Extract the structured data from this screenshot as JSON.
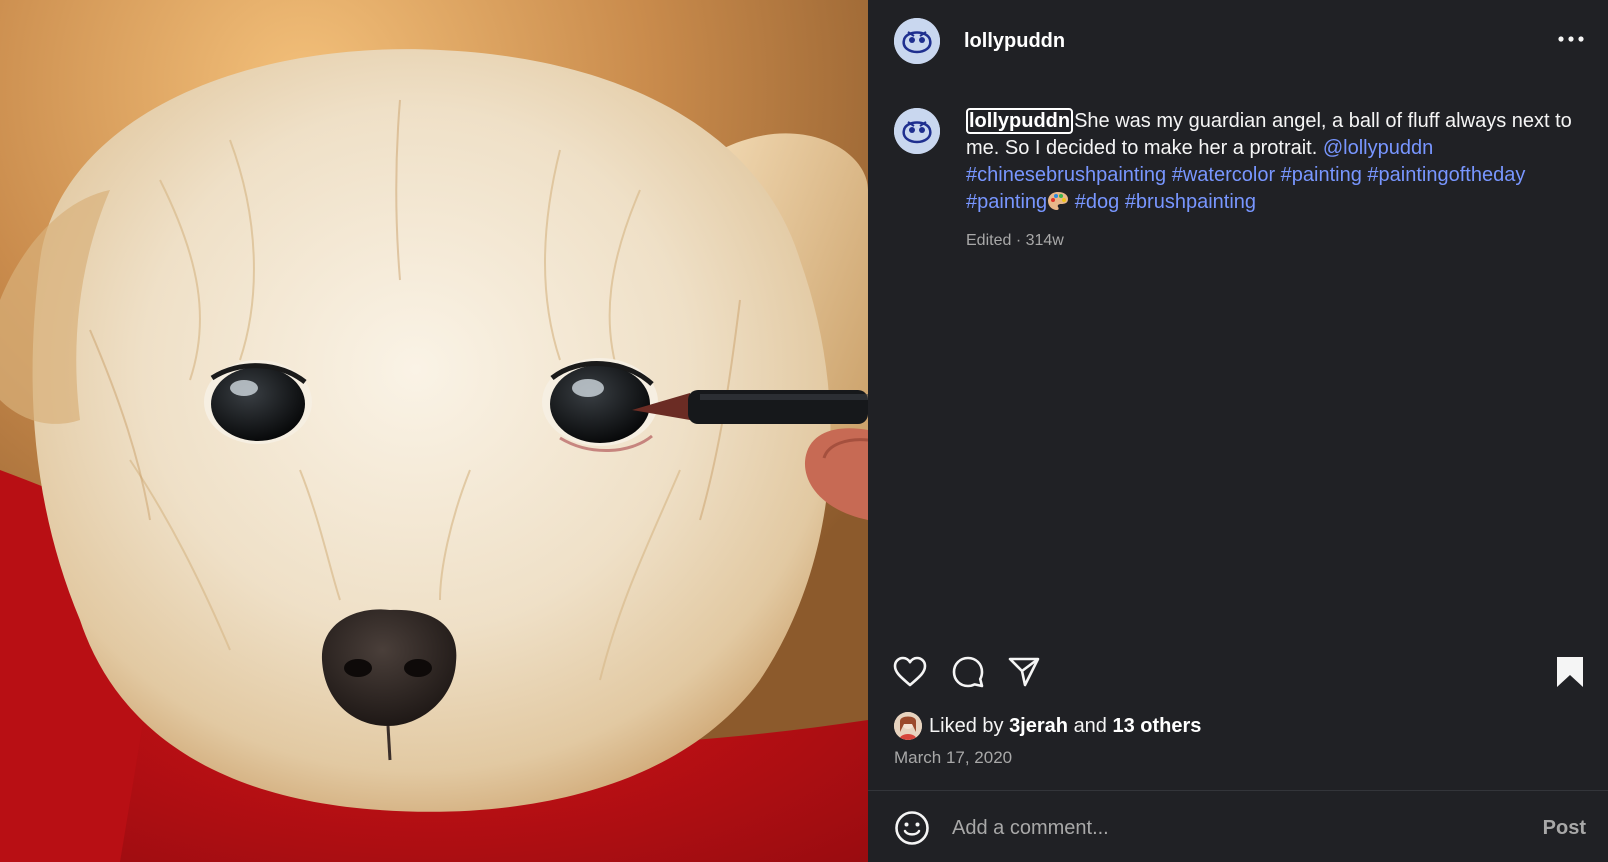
{
  "post": {
    "author": "lollypuddn",
    "caption_text_line": "She was my guardian angel, a ball of fluff always next to me. So I decided to make her a protrait. ",
    "mention": "@lollypuddn",
    "hashtags": [
      "#chinesebrushpainting",
      "#watercolor",
      "#painting",
      "#paintingoftheday",
      "#painting",
      "#dog",
      "#brushpainting"
    ],
    "meta": "Edited · 314w",
    "likes": {
      "prefix": "Liked by ",
      "user": "3jerah",
      "joiner": " and ",
      "others": "13 others"
    },
    "date": "March 17, 2020"
  },
  "comment": {
    "placeholder": "Add a comment...",
    "post_label": "Post"
  },
  "colors": {
    "panel_bg": "#202125",
    "link": "#7896ff",
    "muted": "#a8a8a8"
  },
  "icons": [
    "more-options-icon",
    "heart-icon",
    "comment-icon",
    "share-icon",
    "bookmark-icon",
    "emoji-icon"
  ]
}
